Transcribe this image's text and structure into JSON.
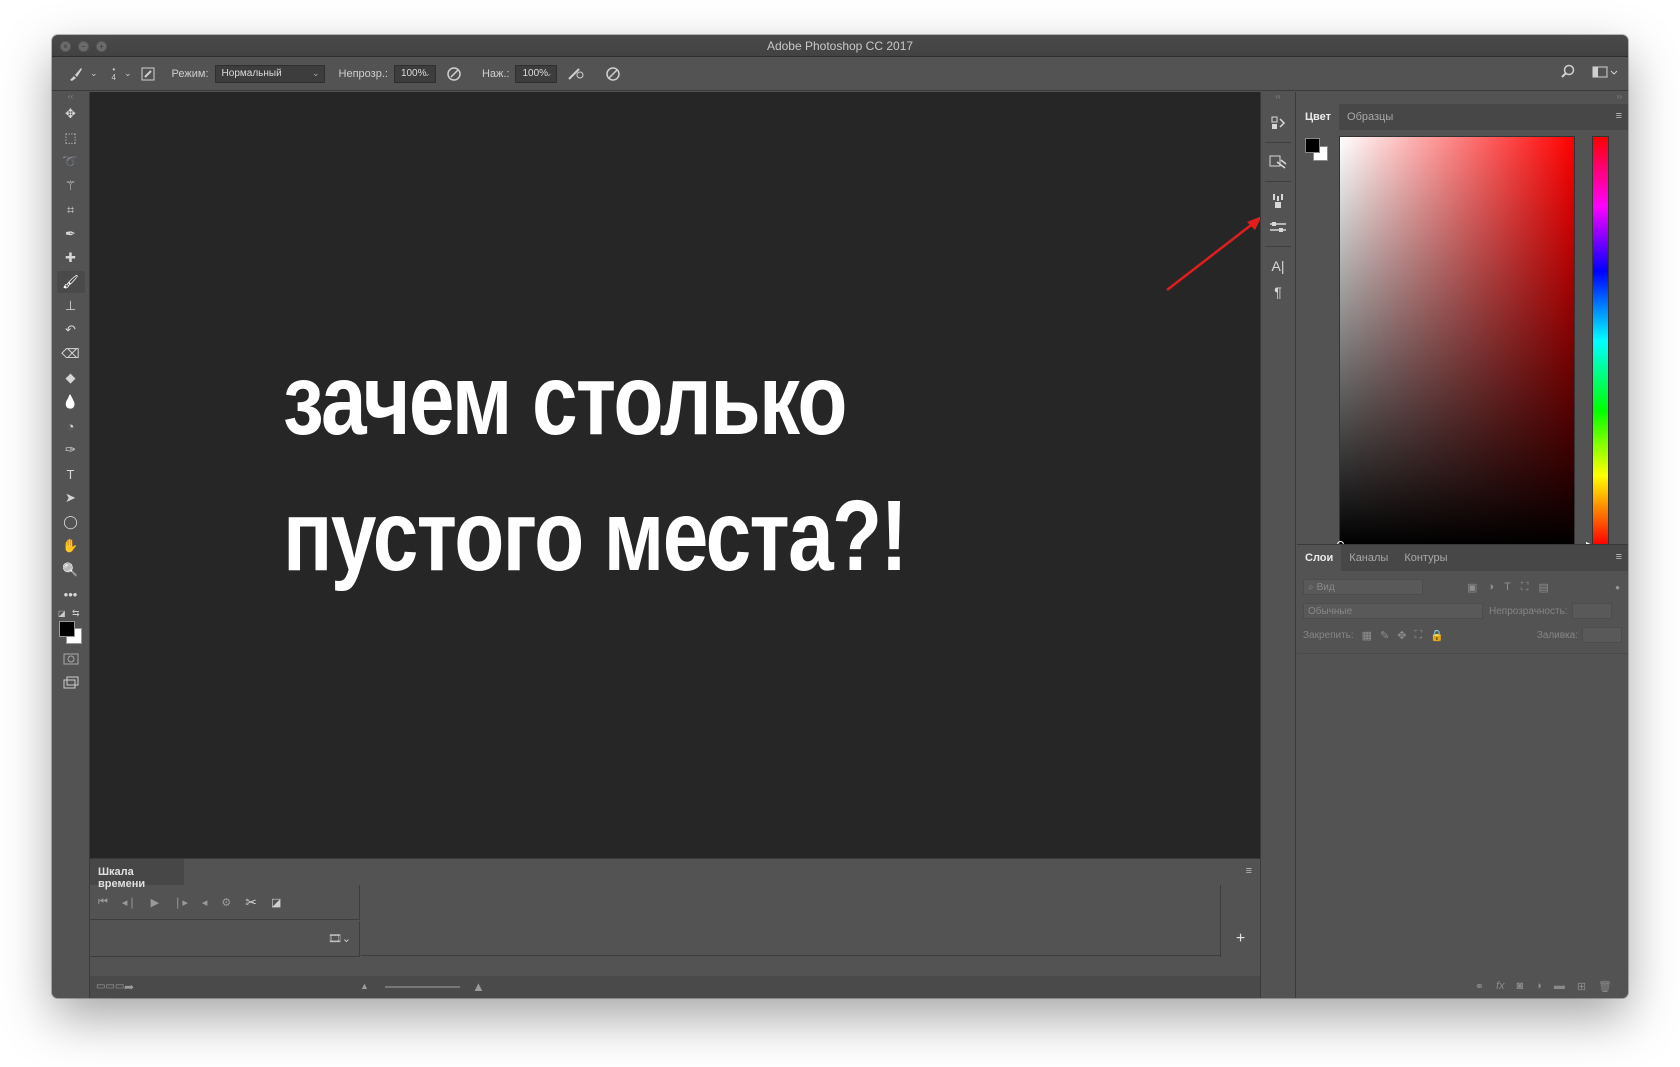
{
  "window": {
    "title": "Adobe Photoshop CC 2017"
  },
  "options_bar": {
    "brush_size": "4",
    "mode_label": "Режим:",
    "mode_value": "Нормальный",
    "opacity_label": "Непрозр.:",
    "opacity_value": "100%",
    "pressure_label": "Наж.:",
    "pressure_value": "100%"
  },
  "canvas": {
    "line1": "зачем столько",
    "line2": "пустого места?!"
  },
  "timeline": {
    "tab_label": "Шкала времени"
  },
  "color_panel": {
    "tabs": [
      "Цвет",
      "Образцы"
    ],
    "foreground": "#000000",
    "background": "#ffffff",
    "hue_color": "#ff0000"
  },
  "layers_panel": {
    "tabs": [
      "Слои",
      "Каналы",
      "Контуры"
    ],
    "filter_placeholder": "Вид",
    "blend_mode": "Обычные",
    "opacity_label": "Непрозрачность:",
    "lock_label": "Закрепить:",
    "fill_label": "Заливка:"
  },
  "annotation": {
    "arrow_color": "#e11d1d"
  },
  "icons": {
    "tools": [
      "move-icon",
      "marquee-icon",
      "lasso-icon",
      "magic-wand-icon",
      "crop-icon",
      "eyedropper-icon",
      "healing-icon",
      "brush-icon",
      "stamp-icon",
      "history-brush-icon",
      "eraser-icon",
      "paint-bucket-icon",
      "blur-icon",
      "dodge-icon",
      "pen-icon",
      "type-icon",
      "path-select-icon",
      "shape-icon",
      "hand-icon",
      "zoom-icon",
      "more-icon"
    ]
  }
}
